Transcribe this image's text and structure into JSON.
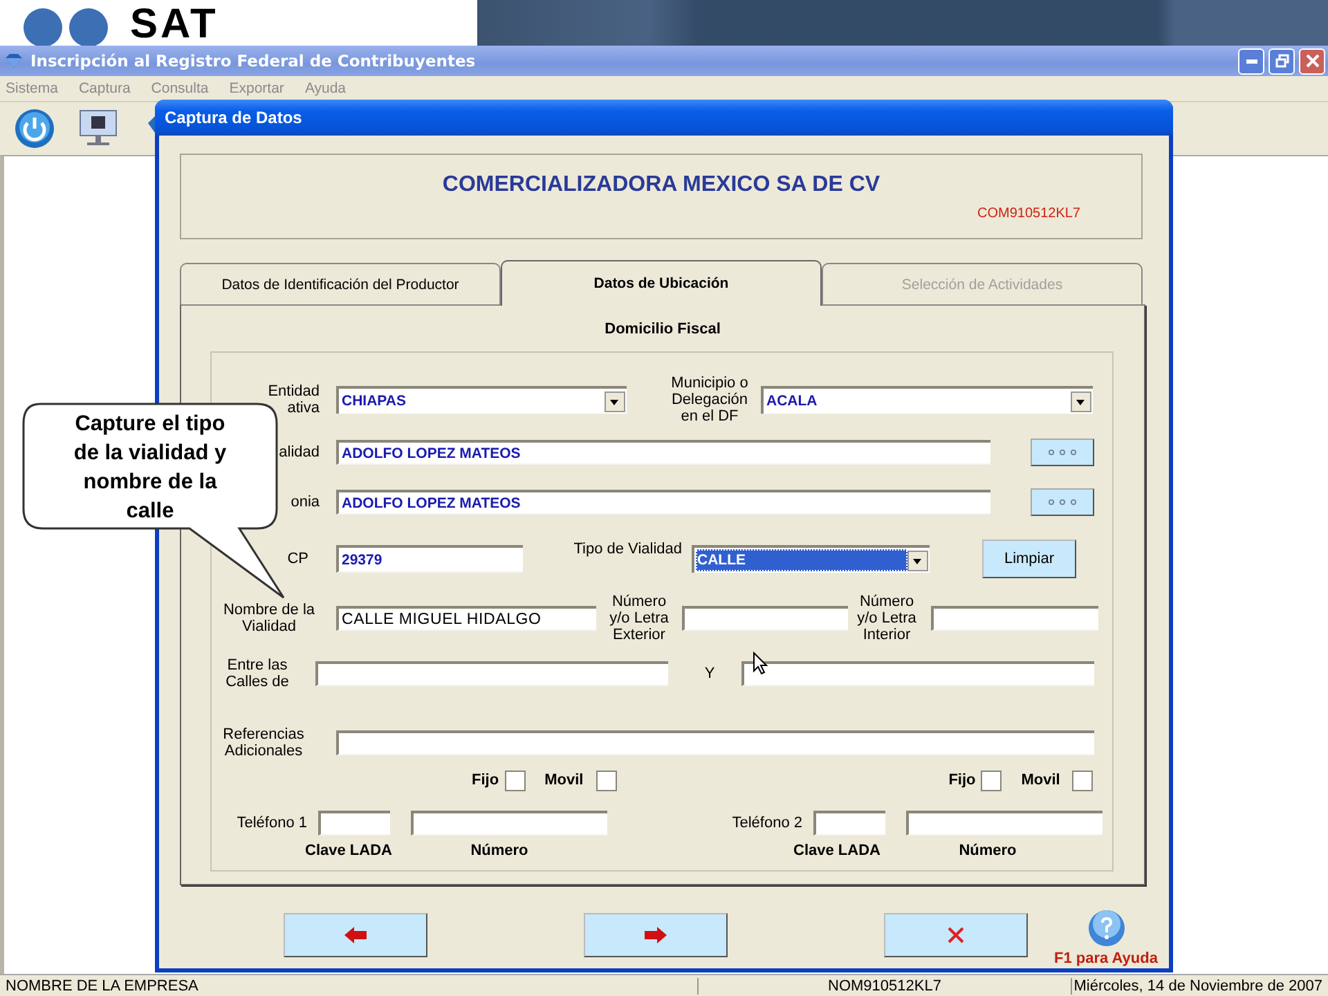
{
  "logo": {
    "text": "SAT"
  },
  "window": {
    "title": "Inscripción al Registro Federal de Contribuyentes"
  },
  "menu": [
    {
      "label": "Sistema",
      "disabled": true
    },
    {
      "label": "Captura",
      "disabled": true
    },
    {
      "label": "Consulta",
      "disabled": true
    },
    {
      "label": "Exportar",
      "disabled": true
    },
    {
      "label": "Ayuda",
      "disabled": true
    }
  ],
  "dialog": {
    "title": "Captura de Datos",
    "company": "COMERCIALIZADORA MEXICO SA DE CV",
    "rfc": "COM910512KL7"
  },
  "tabs": [
    {
      "label": "Datos de Identificación del Productor",
      "selected": false,
      "disabled": false
    },
    {
      "label": "Datos de Ubicación",
      "selected": true,
      "disabled": false
    },
    {
      "label": "Selección de Actividades",
      "selected": false,
      "disabled": true
    }
  ],
  "section_title": "Domicilio Fiscal",
  "entidad": {
    "label_lines": [
      "Entidad",
      "ativa"
    ],
    "value": "CHIAPAS"
  },
  "municipio": {
    "label": "Municipio o Delegación en el DF",
    "value": "ACALA"
  },
  "calle": {
    "label": "alidad",
    "value": "ADOLFO LOPEZ MATEOS"
  },
  "colonia": {
    "label": "onia",
    "value": "ADOLFO LOPEZ MATEOS"
  },
  "cp": {
    "label": "CP",
    "value": "29379"
  },
  "tipo_vialidad": {
    "label": "Tipo de Vialidad",
    "value": "CALLE",
    "selected": true
  },
  "clear_button": "Limpiar",
  "nombre_vialidad": {
    "label": "Nombre de la Vialidad",
    "value": "CALLE MIGUEL HIDALGO"
  },
  "numero_exterior": {
    "label": "Número y/o Letra Exterior"
  },
  "numero_interior": {
    "label": "Número y/o Letra Interior"
  },
  "entre_calles": {
    "label": "Entre las Calles de",
    "and_label": "Y"
  },
  "referencias": {
    "label": "Referencias Adicionales"
  },
  "phones": [
    {
      "label": "Teléfono 1",
      "fijo_label": "Fijo",
      "fijo_checked": false,
      "movil_label": "Movil",
      "movil_checked": false,
      "lada_caption": "Clave LADA",
      "number_caption": "Número"
    },
    {
      "label": "Teléfono 2",
      "fijo_label": "Fijo",
      "fijo_checked": false,
      "movil_label": "Movil",
      "movil_checked": false,
      "lada_caption": "Clave LADA",
      "number_caption": "Número"
    }
  ],
  "help": "F1 para Ayuda",
  "callout": "Capture el tipo\nde la vialidad  y\nnombre de la\ncalle",
  "status_bar": [
    "NOMBRE DE LA EMPRESA",
    "NOM910512KL7",
    "Miércoles, 14 de Noviembre de 2007"
  ]
}
